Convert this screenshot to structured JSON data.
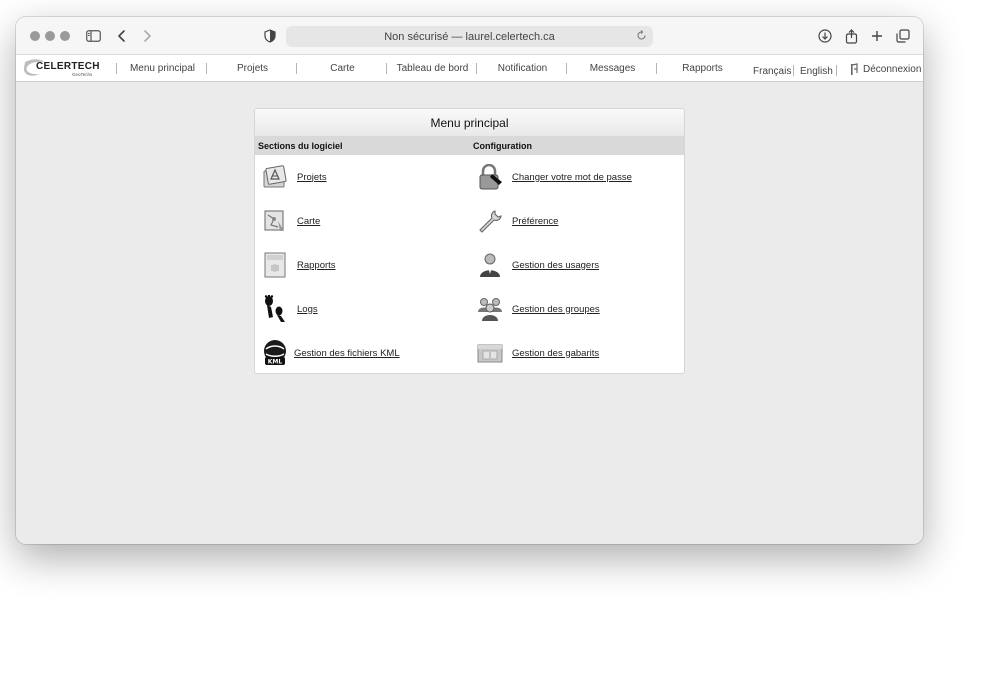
{
  "browser": {
    "url_text": "Non sécurisé — laurel.celertech.ca"
  },
  "logo": {
    "name": "CELERTECH",
    "sub": "GeoTechs"
  },
  "nav": {
    "items": [
      "Menu principal",
      "Projets",
      "Carte",
      "Tableau de bord",
      "Notification",
      "Messages",
      "Rapports"
    ],
    "lang_fr": "Français",
    "lang_en": "English",
    "logout": "Déconnexion"
  },
  "panel": {
    "title": "Menu principal",
    "left_header": "Sections du logiciel",
    "right_header": "Configuration",
    "left_items": [
      {
        "label": "Projets",
        "icon": "projects-icon"
      },
      {
        "label": "Carte",
        "icon": "map-icon"
      },
      {
        "label": "Rapports",
        "icon": "reports-icon"
      },
      {
        "label": "Logs",
        "icon": "footprints-icon"
      },
      {
        "label": "Gestion des fichiers KML",
        "icon": "kml-icon"
      }
    ],
    "right_items": [
      {
        "label": "Changer votre mot de passe",
        "icon": "lock-icon"
      },
      {
        "label": "Préférence",
        "icon": "wrench-icon"
      },
      {
        "label": "Gestion des usagers",
        "icon": "user-icon"
      },
      {
        "label": "Gestion des groupes",
        "icon": "group-icon"
      },
      {
        "label": "Gestion des gabarits",
        "icon": "template-icon"
      }
    ]
  }
}
